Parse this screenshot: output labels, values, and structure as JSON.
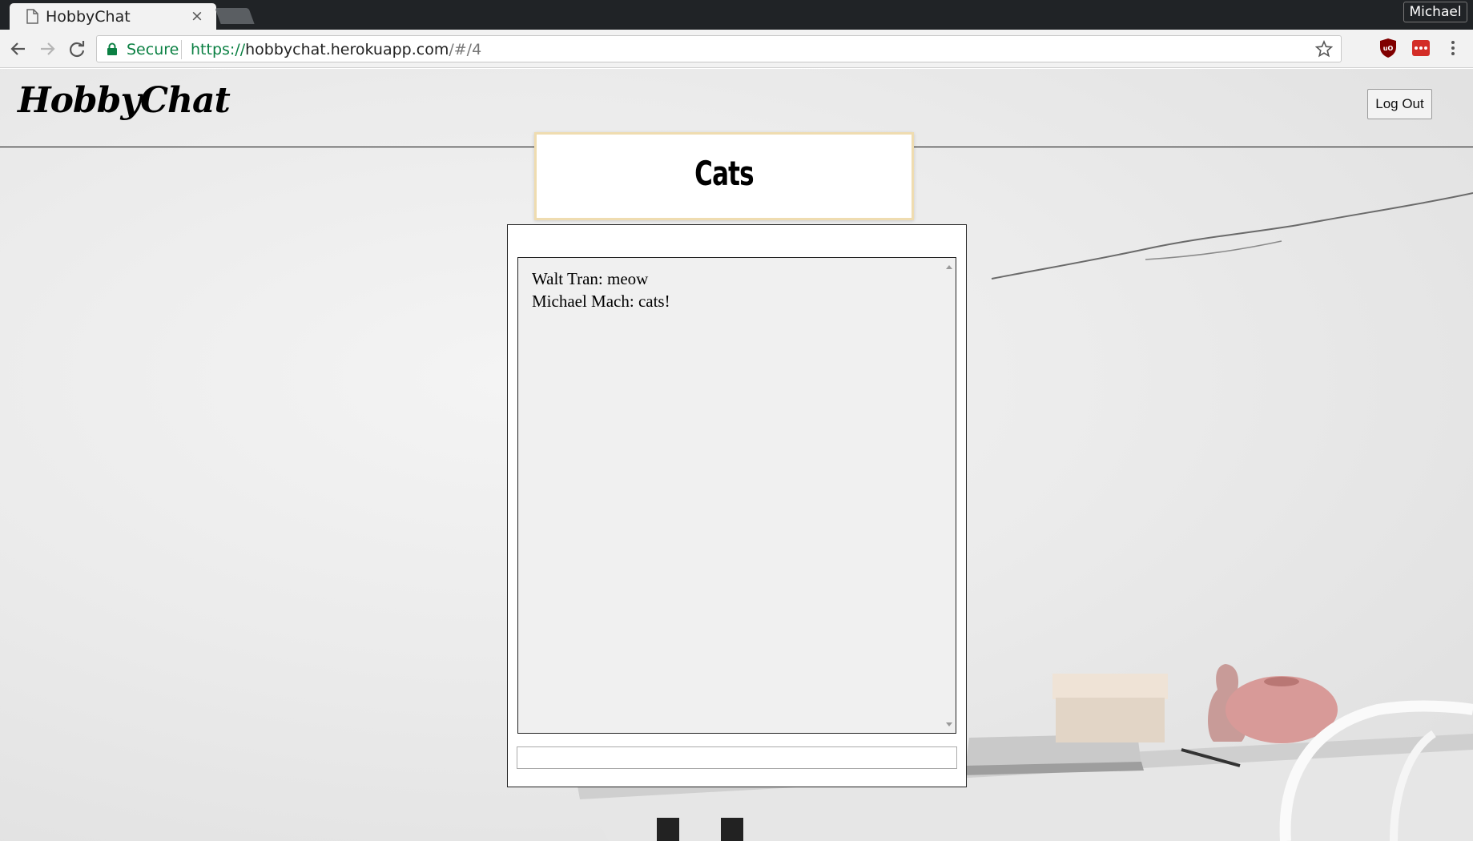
{
  "browser": {
    "tab_title": "HobbyChat",
    "tab_close": "×",
    "profile_name": "Michael",
    "secure_label": "Secure",
    "url_scheme": "https://",
    "url_host": "hobbychat.herokuapp.com",
    "url_path": "/#/4",
    "icons": [
      "document-icon",
      "back-icon",
      "forward-icon",
      "reload-icon",
      "lock-icon",
      "star-icon",
      "ublock-icon",
      "lastpass-icon",
      "menu-icon"
    ],
    "colors": {
      "secure": "#0b8043",
      "titlebar": "#202326"
    }
  },
  "header": {
    "logo": "HobbyChat",
    "logout_label": "Log Out"
  },
  "room": {
    "title": "Cats"
  },
  "chat": {
    "messages": [
      {
        "text": "Walt Tran: meow"
      },
      {
        "text": "Michael Mach: cats!"
      }
    ],
    "input_value": ""
  }
}
